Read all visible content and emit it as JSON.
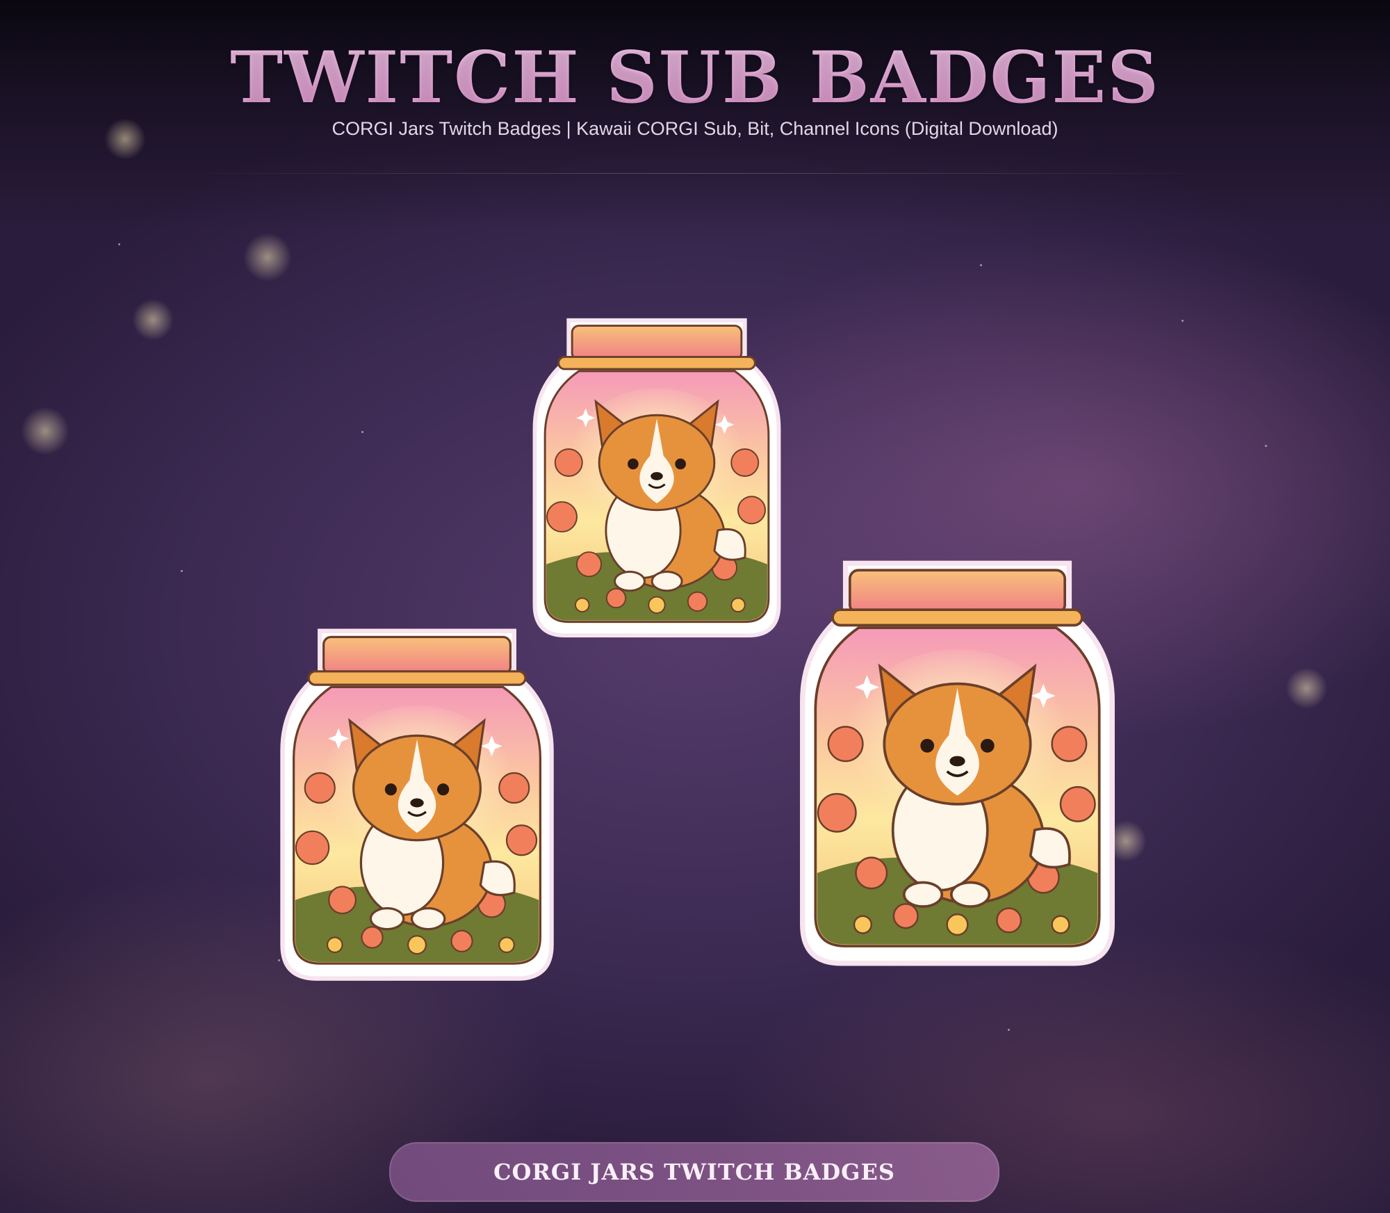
{
  "header": {
    "title": "TWITCH SUB BADGES",
    "subtitle": "CORGI Jars Twitch Badges | Kawaii CORGI Sub, Bit, Channel Icons (Digital Download)"
  },
  "badges": [
    {
      "name": "Corgi jar badge"
    },
    {
      "name": "Corgi jar badge"
    },
    {
      "name": "Corgi jar badge"
    }
  ],
  "footer": {
    "caption": "CORGI JARS TWITCH BADGES"
  },
  "colors": {
    "title_pink": "#e9a6d8",
    "background_purple": "#4a3360",
    "jar_lid": "#f3a07c",
    "corgi_orange": "#e48c3a"
  }
}
